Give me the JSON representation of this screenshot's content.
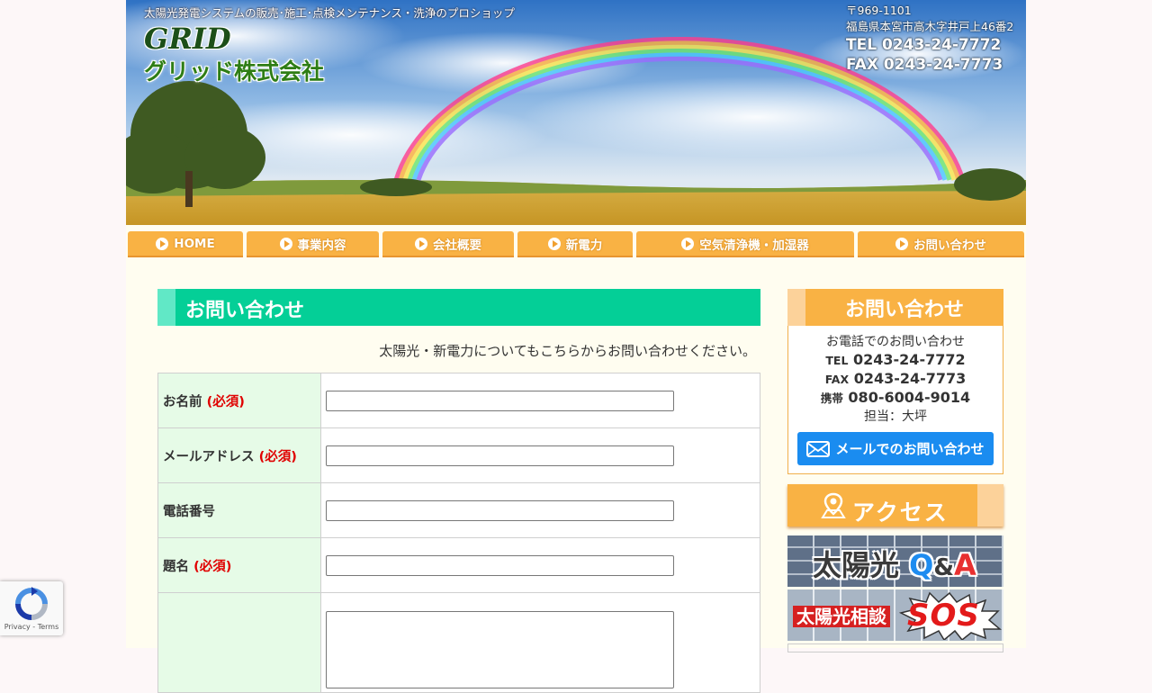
{
  "header": {
    "tagline": "太陽光発電システムの販売･施工･点検メンテナンス・洗浄のプロショップ",
    "logo_en": "GRID",
    "logo_ja": "グリッド株式会社",
    "postal": "〒969-1101",
    "address": "福島県本宮市高木字井戸上46番2",
    "tel": "TEL 0243-24-7772",
    "fax": "FAX 0243-24-7773"
  },
  "nav": {
    "items": [
      "HOME",
      "事業内容",
      "会社概要",
      "新電力",
      "空気清浄機・加湿器",
      "お問い合わせ"
    ]
  },
  "main": {
    "heading": "お問い合わせ",
    "intro": "太陽光・新電力についてもこちらからお問い合わせください。",
    "required_mark": "(必須)",
    "fields": [
      {
        "label": "お名前",
        "value": ""
      },
      {
        "label": "メールアドレス",
        "value": ""
      },
      {
        "label": "電話番号",
        "value": ""
      },
      {
        "label": "題名",
        "value": ""
      },
      {
        "label": "",
        "value": ""
      }
    ]
  },
  "sidebar": {
    "contact_heading": "お問い合わせ",
    "phone_intro": "お電話でのお問い合わせ",
    "tel_label": "TEL",
    "tel": "0243-24-7772",
    "fax_label": "FAX",
    "fax": "0243-24-7773",
    "mobile_label": "携帯",
    "mobile": "080-6004-9014",
    "person": "担当：大坪",
    "mail_button": "メールでのお問い合わせ",
    "access_label": "アクセス",
    "qa_banner_text": "太陽光",
    "qa_q": "Q",
    "qa_amp": "&",
    "qa_a": "A",
    "sos_banner_text": "太陽光相談",
    "sos_text": "SOS"
  },
  "recaptcha": {
    "privacy": "Privacy",
    "sep": " - ",
    "terms": "Terms"
  },
  "colors": {
    "nav_orange": "#f9b244",
    "heading_green": "#04cf97",
    "label_bg": "#e6fbe7",
    "required_red": "#e00000",
    "mail_blue": "#1a8cf0"
  }
}
